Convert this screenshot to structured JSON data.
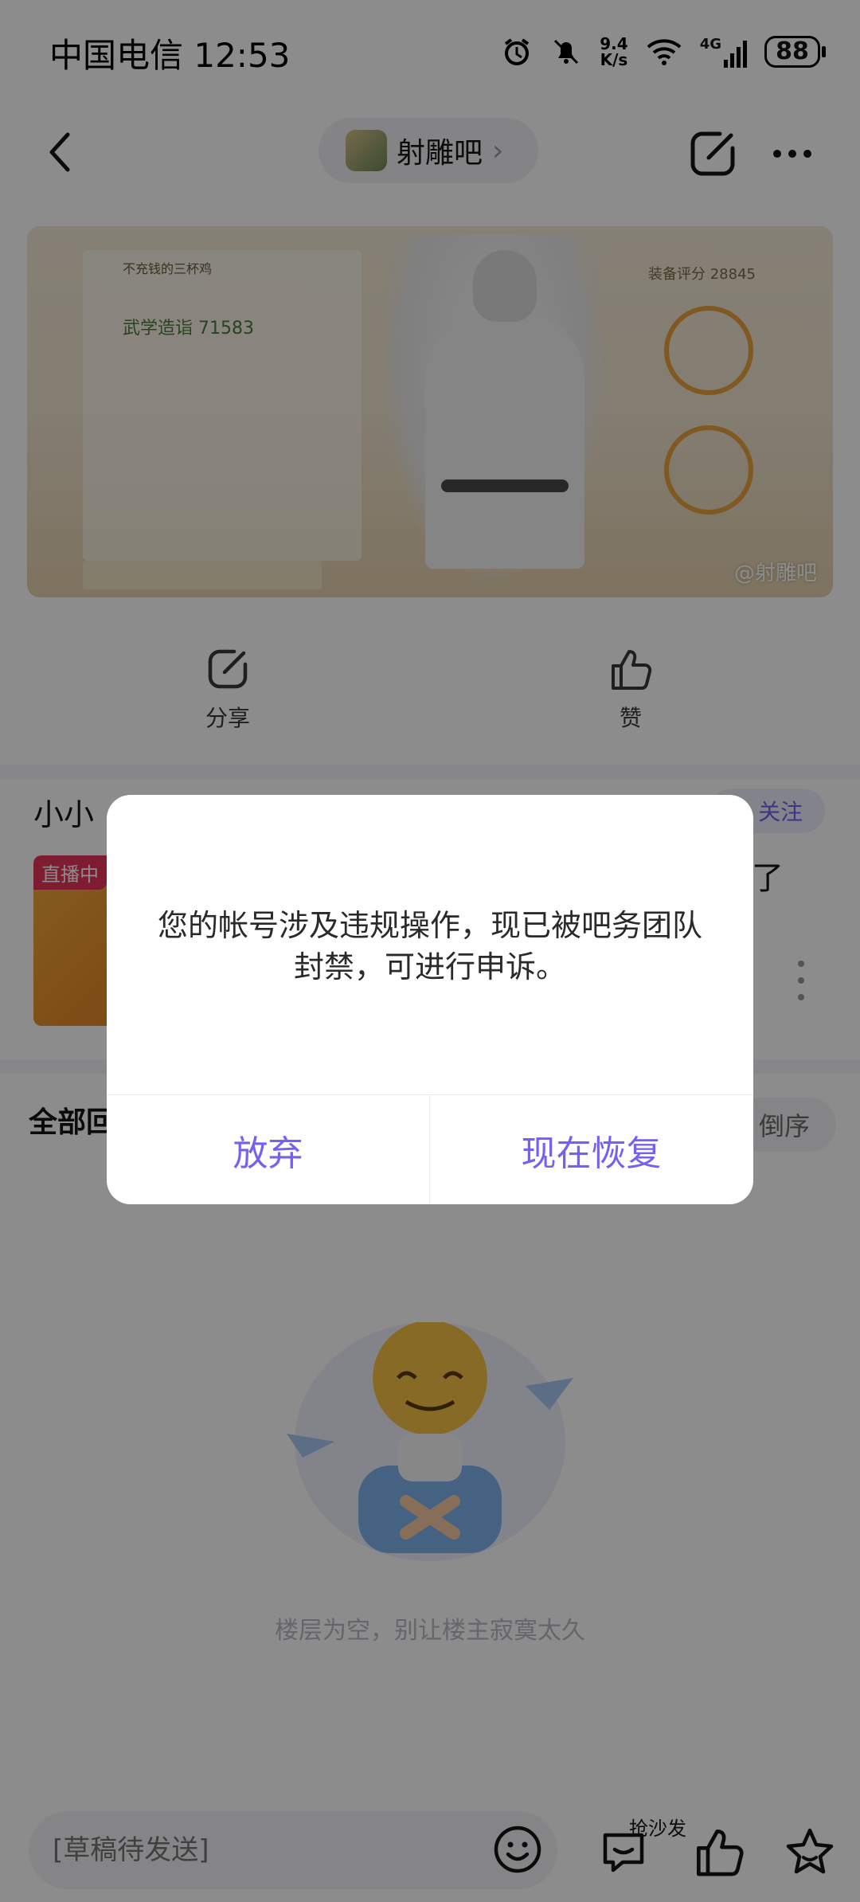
{
  "status_bar": {
    "carrier_time": "中国电信 12:53",
    "net_speed_value": "9.4",
    "net_speed_unit": "K/s",
    "network": "4G",
    "battery": "88"
  },
  "nav": {
    "forum_name": "射雕吧",
    "forum_chevron": "›"
  },
  "banner": {
    "watermark": "@射雕吧",
    "char_name": "不充钱的三杯鸡",
    "power_label": "武学造诣 71583",
    "equip_score": "装备评分 28845"
  },
  "actions": {
    "share_label": "分享",
    "like_label": "赞"
  },
  "post": {
    "author": "小小",
    "follow_label": "+ 关注",
    "live_tag": "直播中",
    "tail_text": "了"
  },
  "replies": {
    "title": "全部回",
    "sort_label": "倒序"
  },
  "empty_state": {
    "text": "楼层为空，别让楼主寂寞太久"
  },
  "bottom_bar": {
    "draft_placeholder": "[草稿待发送]",
    "sofa_label": "抢沙发"
  },
  "dialog": {
    "message": "您的帐号涉及违规操作，现已被吧务团队封禁，可进行申诉。",
    "abandon_label": "放弃",
    "restore_label": "现在恢复"
  },
  "colors": {
    "accent": "#7561f1",
    "overlay": "rgba(0,0,0,0.45)"
  }
}
